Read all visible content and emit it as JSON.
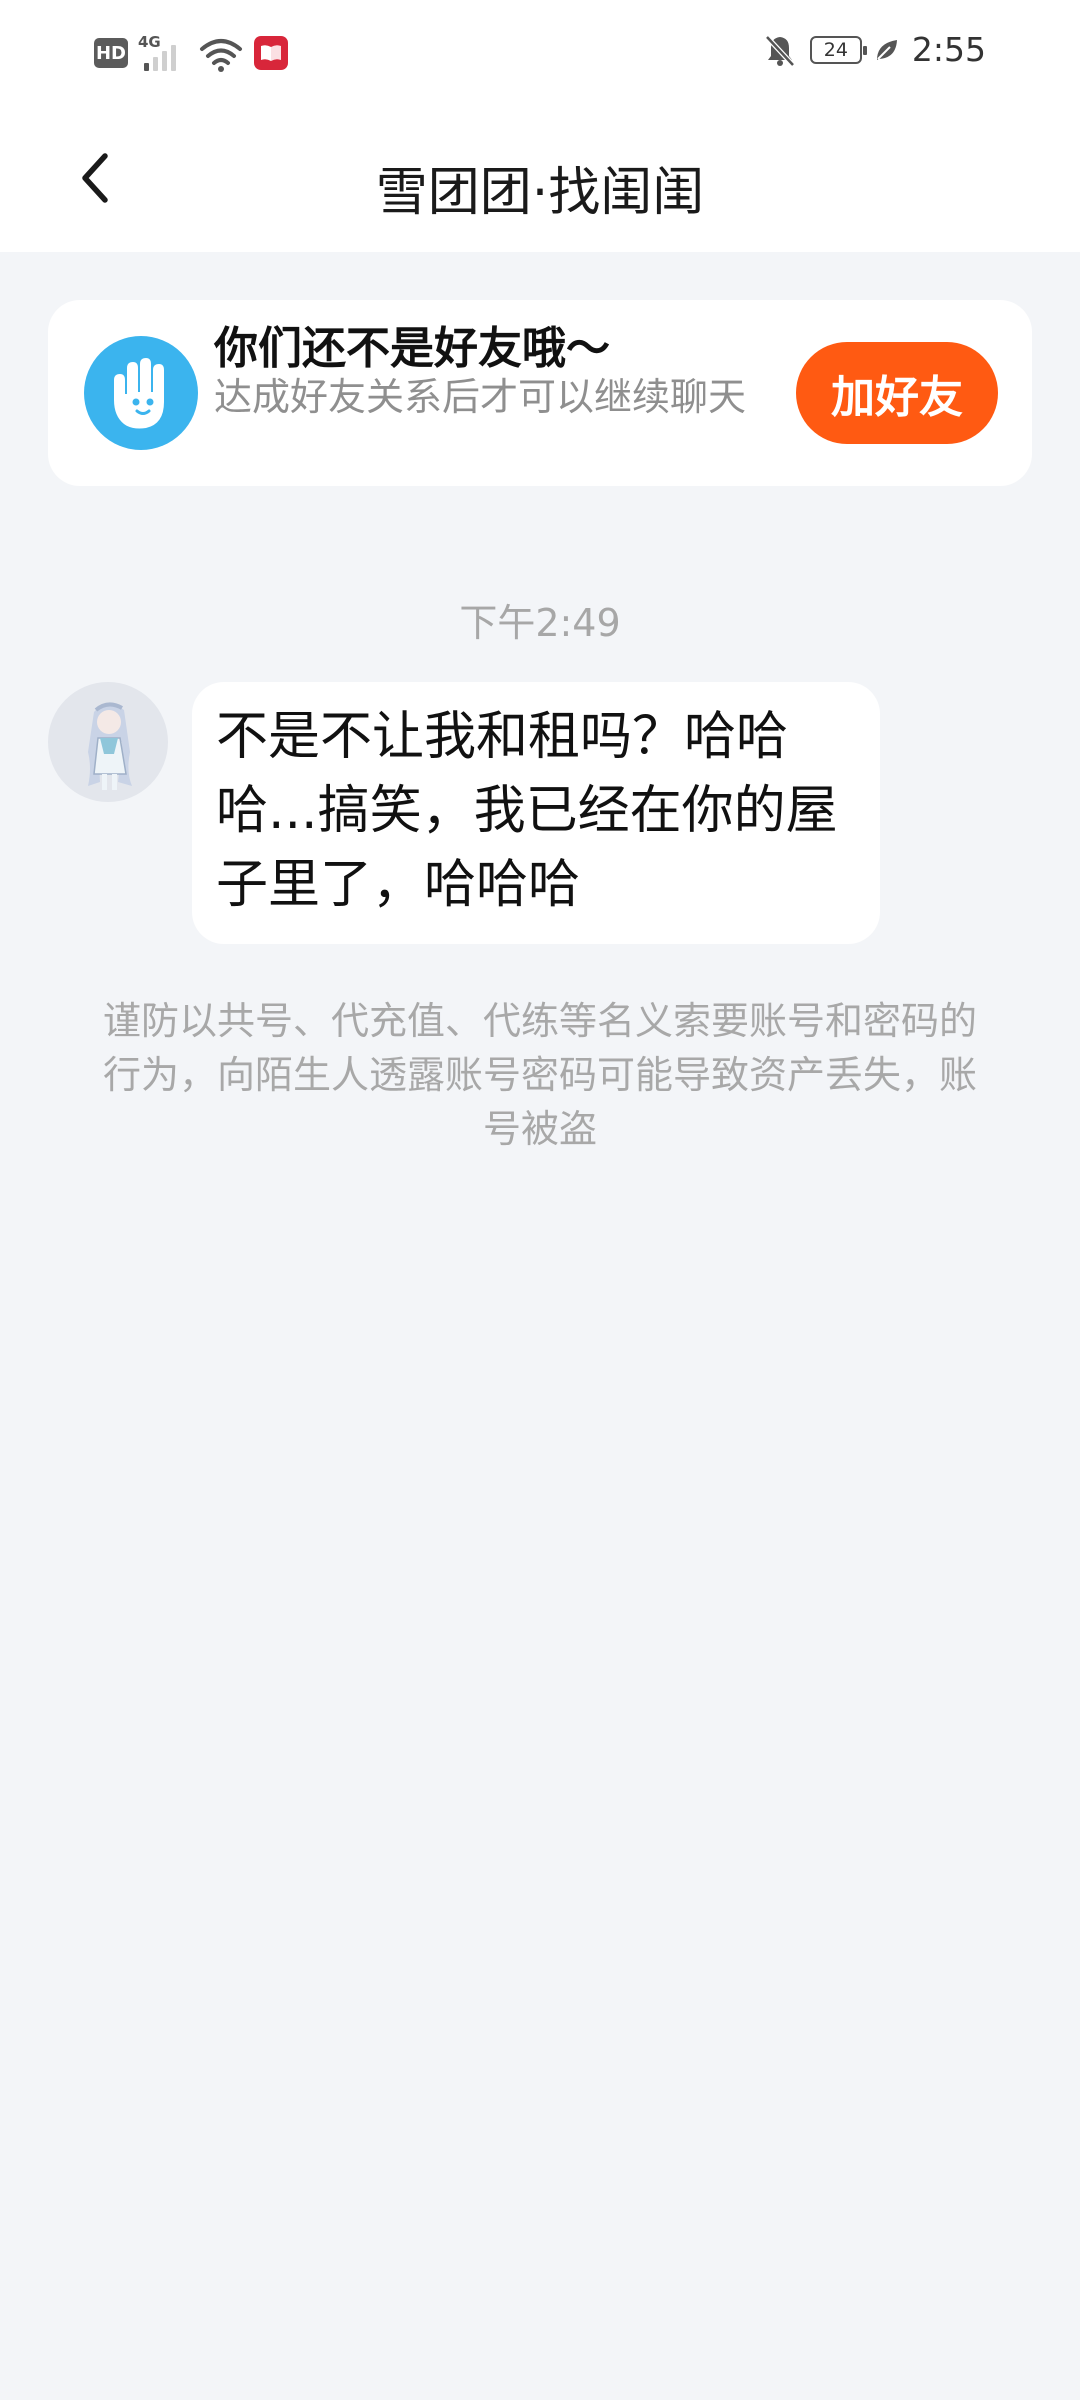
{
  "status_bar": {
    "hd": "HD",
    "network": "4G",
    "battery": "24",
    "time": "2:55"
  },
  "header": {
    "title": "雪团团·找闺闺"
  },
  "banner": {
    "title": "你们还不是好友哦～",
    "subtitle": "达成好友关系后才可以继续聊天",
    "add_button": "加好友"
  },
  "chat": {
    "timestamp": "下午2:49",
    "messages": [
      {
        "sender": "other",
        "text": "不是不让我和租吗？哈哈哈...搞笑，我已经在你的屋子里了，哈哈哈"
      }
    ],
    "warning": "谨防以共号、代充值、代练等名义索要账号和密码的行为，向陌生人透露账号密码可能导致资产丢失，账号被盗"
  },
  "colors": {
    "accent": "#ff5a12",
    "icon_blue": "#3bb4ee",
    "background": "#f3f5f8"
  }
}
